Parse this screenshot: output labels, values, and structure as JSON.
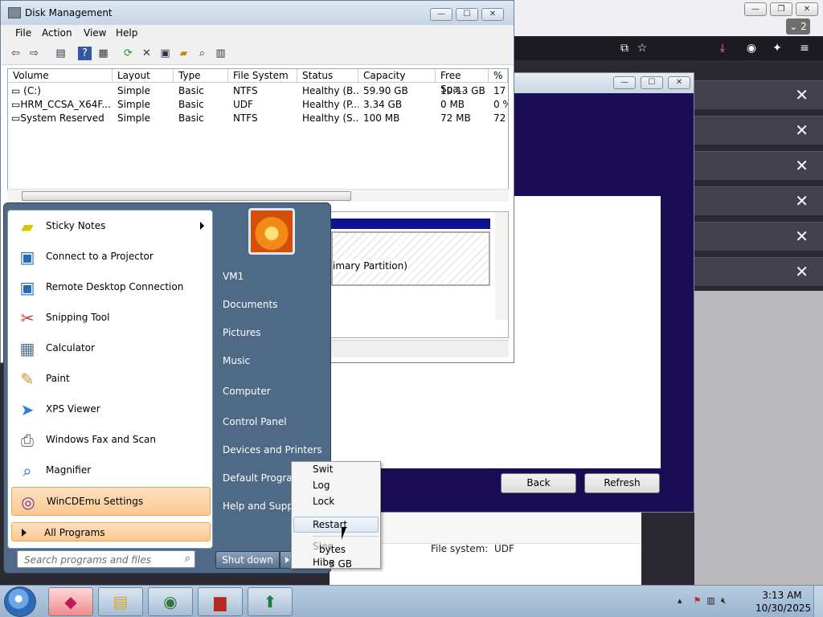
{
  "browser": {
    "tab_count": "2",
    "toolbar_icons": [
      "screenshot-icon",
      "star-icon",
      "download-icon",
      "account-icon",
      "extensions-icon",
      "menu-icon"
    ],
    "downloads_rows": 6
  },
  "installer": {
    "back_label": "Back",
    "refresh_label": "Refresh"
  },
  "details": {
    "file_system_label": "File system:",
    "file_system_value": "UDF",
    "size_fragment": "bytes",
    "size_gb_fragment": "3 GB"
  },
  "disk_management": {
    "title": "Disk Management",
    "menu": [
      "File",
      "Action",
      "View",
      "Help"
    ],
    "columns": [
      "Volume",
      "Layout",
      "Type",
      "File System",
      "Status",
      "Capacity",
      "Free Spa...",
      "% F"
    ],
    "rows": [
      [
        "(C:)",
        "Simple",
        "Basic",
        "NTFS",
        "Healthy (B...",
        "59.90 GB",
        "10.13 GB",
        "17"
      ],
      [
        "HRM_CCSA_X64F...",
        "Simple",
        "Basic",
        "UDF",
        "Healthy (P...",
        "3.34 GB",
        "0 MB",
        "0 %"
      ],
      [
        "System Reserved",
        "Simple",
        "Basic",
        "NTFS",
        "Healthy (S...",
        "100 MB",
        "72 MB",
        "72"
      ]
    ],
    "partition_label": "imary Partition)"
  },
  "start_menu": {
    "programs": [
      {
        "label": "Sticky Notes",
        "icon": "sticky-notes-icon",
        "submenu": true
      },
      {
        "label": "Connect to a Projector",
        "icon": "projector-icon"
      },
      {
        "label": "Remote Desktop Connection",
        "icon": "remote-desktop-icon"
      },
      {
        "label": "Snipping Tool",
        "icon": "scissors-icon"
      },
      {
        "label": "Calculator",
        "icon": "calculator-icon"
      },
      {
        "label": "Paint",
        "icon": "paint-palette-icon"
      },
      {
        "label": "XPS Viewer",
        "icon": "xps-viewer-icon"
      },
      {
        "label": "Windows Fax and Scan",
        "icon": "fax-icon"
      },
      {
        "label": "Magnifier",
        "icon": "magnifier-icon"
      },
      {
        "label": "WinCDEmu Settings",
        "icon": "wincdemu-icon",
        "highlight": true
      }
    ],
    "all_programs": "All Programs",
    "search_placeholder": "Search programs and files",
    "right_links": [
      "VM1",
      "Documents",
      "Pictures",
      "Music",
      "Computer",
      "Control Panel",
      "Devices and Printers",
      "Default Program",
      "Help and Suppo"
    ],
    "shutdown_label": "Shut down"
  },
  "shutdown_submenu": {
    "items": [
      "Swit",
      "Log",
      "Lock",
      "Restart",
      "Slee",
      "Hibe"
    ],
    "highlighted": "Restart",
    "disabled": [
      "Slee"
    ]
  },
  "taskbar": {
    "apps": [
      "ribbon-app-icon",
      "file-explorer-icon",
      "browser-globe-icon",
      "toolbox-icon",
      "installer-icon"
    ],
    "time": "3:13 AM",
    "date": "10/30/2025",
    "tray_icons": [
      "show-hidden-icon",
      "network-error-icon",
      "network-icon",
      "volume-muted-icon"
    ]
  },
  "colors": {
    "installer_bg": "#1b0c56",
    "highlight": "#fbc891",
    "start_menu": "#4f6a86"
  }
}
